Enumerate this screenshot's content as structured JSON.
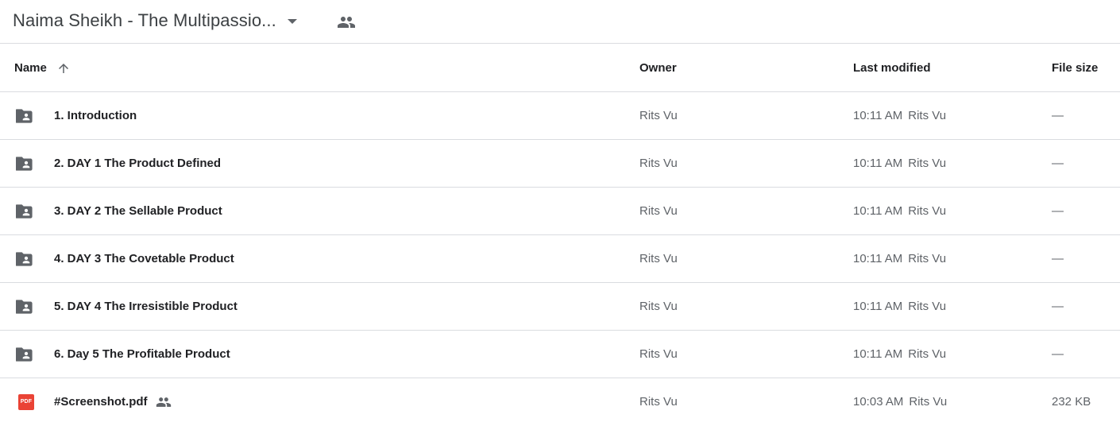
{
  "header": {
    "folder_title": "Naima Sheikh - The Multipassio..."
  },
  "columns": {
    "name": "Name",
    "owner": "Owner",
    "last_modified": "Last modified",
    "file_size": "File size"
  },
  "sort": {
    "column": "Name",
    "direction": "ascending",
    "icon": "arrow-up-icon"
  },
  "files": [
    {
      "name": "1. Introduction",
      "type": "shared-folder",
      "owner": "Rits Vu",
      "modified_time": "10:11 AM",
      "modified_by": "Rits Vu",
      "size": "—"
    },
    {
      "name": "2. DAY 1 The Product Defined",
      "type": "shared-folder",
      "owner": "Rits Vu",
      "modified_time": "10:11 AM",
      "modified_by": "Rits Vu",
      "size": "—"
    },
    {
      "name": "3. DAY 2 The Sellable Product",
      "type": "shared-folder",
      "owner": "Rits Vu",
      "modified_time": "10:11 AM",
      "modified_by": "Rits Vu",
      "size": "—"
    },
    {
      "name": "4. DAY 3 The Covetable Product",
      "type": "shared-folder",
      "owner": "Rits Vu",
      "modified_time": "10:11 AM",
      "modified_by": "Rits Vu",
      "size": "—"
    },
    {
      "name": "5. DAY 4 The Irresistible Product",
      "type": "shared-folder",
      "owner": "Rits Vu",
      "modified_time": "10:11 AM",
      "modified_by": "Rits Vu",
      "size": "—"
    },
    {
      "name": "6. Day 5 The Profitable Product",
      "type": "shared-folder",
      "owner": "Rits Vu",
      "modified_time": "10:11 AM",
      "modified_by": "Rits Vu",
      "size": "—"
    },
    {
      "name": "#Screenshot.pdf",
      "type": "pdf",
      "shared": true,
      "owner": "Rits Vu",
      "modified_time": "10:03 AM",
      "modified_by": "Rits Vu",
      "size": "232 KB"
    }
  ],
  "icons": {
    "pdf_label": "PDF",
    "folder_color": "#5f6368",
    "pdf_color": "#ea4335"
  }
}
